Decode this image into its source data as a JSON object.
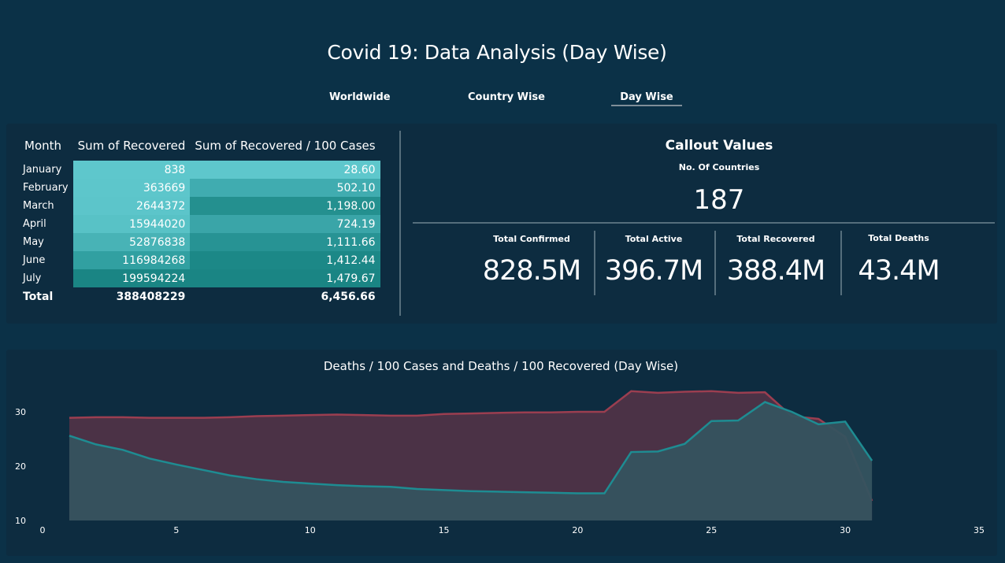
{
  "page": {
    "title": "Covid 19: Data Analysis (Day Wise)"
  },
  "nav": {
    "tabs": [
      {
        "label": "Worldwide"
      },
      {
        "label": "Country Wise"
      },
      {
        "label": "Day Wise",
        "active": true
      }
    ]
  },
  "table": {
    "headers": [
      "Month",
      "Sum of Recovered",
      "Sum of Recovered / 100 Cases"
    ],
    "rows": [
      {
        "month": "January",
        "recovered": "838",
        "per100": "28.60"
      },
      {
        "month": "February",
        "recovered": "363669",
        "per100": "502.10"
      },
      {
        "month": "March",
        "recovered": "2644372",
        "per100": "1,198.00"
      },
      {
        "month": "April",
        "recovered": "15944020",
        "per100": "724.19"
      },
      {
        "month": "May",
        "recovered": "52876838",
        "per100": "1,111.66"
      },
      {
        "month": "June",
        "recovered": "116984268",
        "per100": "1,412.44"
      },
      {
        "month": "July",
        "recovered": "199594224",
        "per100": "1,479.67"
      }
    ],
    "total": {
      "label": "Total",
      "recovered": "388408229",
      "per100": "6,456.66"
    }
  },
  "callout": {
    "title": "Callout Values",
    "countries_label": "No. Of Countries",
    "countries_value": "187",
    "cards": [
      {
        "label": "Total Confirmed",
        "value": "828.5M"
      },
      {
        "label": "Total Active",
        "value": "396.7M"
      },
      {
        "label": "Total Recovered",
        "value": "388.4M"
      },
      {
        "label": "Total Deaths",
        "value": "43.4M"
      }
    ]
  },
  "colors": {
    "background": "#0b3147",
    "panel": "#0d2c40",
    "deaths_per_100_cases": "#8f3a4b",
    "deaths_per_100_recovered": "#1e8c92"
  },
  "chart_data": {
    "type": "area",
    "title": "Deaths / 100 Cases and Deaths / 100 Recovered (Day Wise)",
    "xlim": [
      0,
      35
    ],
    "ylim": [
      10,
      30
    ],
    "xticks": [
      0,
      5,
      10,
      15,
      20,
      25,
      30,
      35
    ],
    "yticks": [
      10,
      20,
      30
    ],
    "x": [
      1,
      2,
      3,
      4,
      5,
      6,
      7,
      8,
      9,
      10,
      11,
      12,
      13,
      14,
      15,
      16,
      17,
      18,
      19,
      20,
      21,
      22,
      23,
      24,
      25,
      26,
      27,
      28,
      29,
      30,
      31
    ],
    "series": [
      {
        "color": "#9b3e50",
        "values": [
          28.9,
          29.0,
          29.0,
          28.9,
          28.9,
          28.9,
          29.0,
          29.2,
          29.3,
          29.4,
          29.5,
          29.4,
          29.3,
          29.3,
          29.6,
          29.7,
          29.8,
          29.9,
          29.9,
          30.0,
          30.0,
          33.8,
          33.5,
          33.7,
          33.8,
          33.5,
          33.6,
          29.2,
          28.7,
          25.4,
          13.6
        ]
      },
      {
        "color": "#1e8c92",
        "values": [
          25.6,
          24.0,
          23.0,
          21.4,
          20.3,
          19.3,
          18.3,
          17.6,
          17.1,
          16.8,
          16.5,
          16.3,
          16.2,
          15.8,
          15.6,
          15.4,
          15.3,
          15.2,
          15.1,
          15.0,
          15.0,
          22.6,
          22.7,
          24.1,
          28.3,
          28.4,
          31.8,
          30.0,
          27.7,
          28.2,
          21.0
        ]
      }
    ]
  }
}
